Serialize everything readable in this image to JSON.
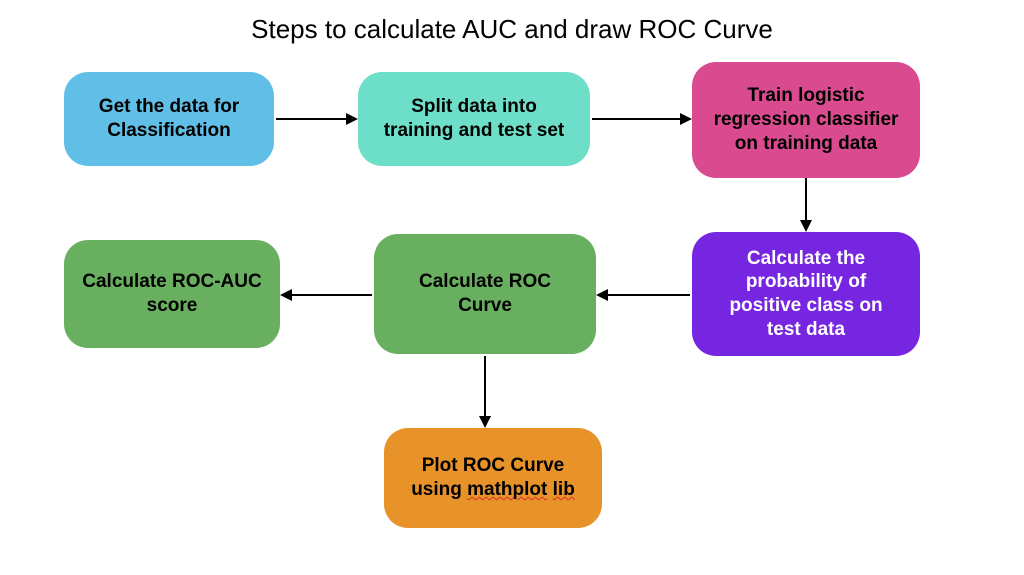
{
  "title": "Steps to calculate AUC and draw ROC Curve",
  "boxes": {
    "step1": {
      "label": "Get the data for Classification",
      "color": "#61bfe7"
    },
    "step2": {
      "label": "Split data into training and test set",
      "color": "#6ddec8"
    },
    "step3": {
      "label": "Train logistic regression classifier on training data",
      "color": "#d94b8e"
    },
    "step4": {
      "label": "Calculate the probability of positive class on test data",
      "color": "#7626e0"
    },
    "step5": {
      "label": "Calculate ROC Curve",
      "color": "#68b05f"
    },
    "step6": {
      "label": "Calculate ROC-AUC score",
      "color": "#68b05f"
    },
    "step7_pre": "Plot  ROC Curve using ",
    "step7_u1": "mathplot",
    "step7_sp": " ",
    "step7_u2": "lib",
    "step7_color": "#e8922a"
  }
}
